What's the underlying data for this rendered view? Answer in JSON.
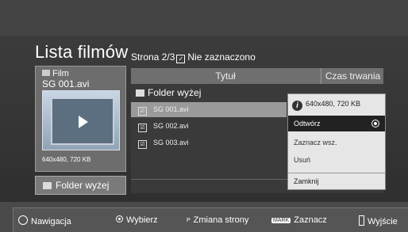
{
  "page": {
    "title": "Lista filmów",
    "status": {
      "page": "Strona 2/3",
      "selection": "Nie zaznaczono"
    }
  },
  "preview": {
    "type_label": "Film",
    "file_name": "SG 001.avi",
    "meta": "640x480, 720 KB",
    "up_button_label": "Folder wyżej"
  },
  "list": {
    "columns": {
      "title": "Tytuł",
      "duration": "Czas trwania"
    },
    "up_row_label": "Folder wyżej",
    "items": [
      {
        "name": "SG 001.avi",
        "check": "☑"
      },
      {
        "name": "SG 002.avi",
        "check": "☑"
      },
      {
        "name": "SG 003.avi",
        "check": "☑"
      }
    ]
  },
  "popup": {
    "info": "640x480, 720 KB",
    "info_icon": "i",
    "options": [
      "Odtwórz",
      "Zaznacz wsz.",
      "Usuń"
    ],
    "close_label": "Zamknij"
  },
  "footer": {
    "navigate": "Nawigacja",
    "select": "Wybierz",
    "page_change_icon": "P",
    "page_change": "Zmiana strony",
    "mark_icon": "MARK",
    "mark": "Zaznacz",
    "exit": "Wyjście"
  },
  "colors": {
    "background": "#4a4a4a",
    "popup_bg": "#e6e6e6",
    "highlight": "#222222"
  }
}
